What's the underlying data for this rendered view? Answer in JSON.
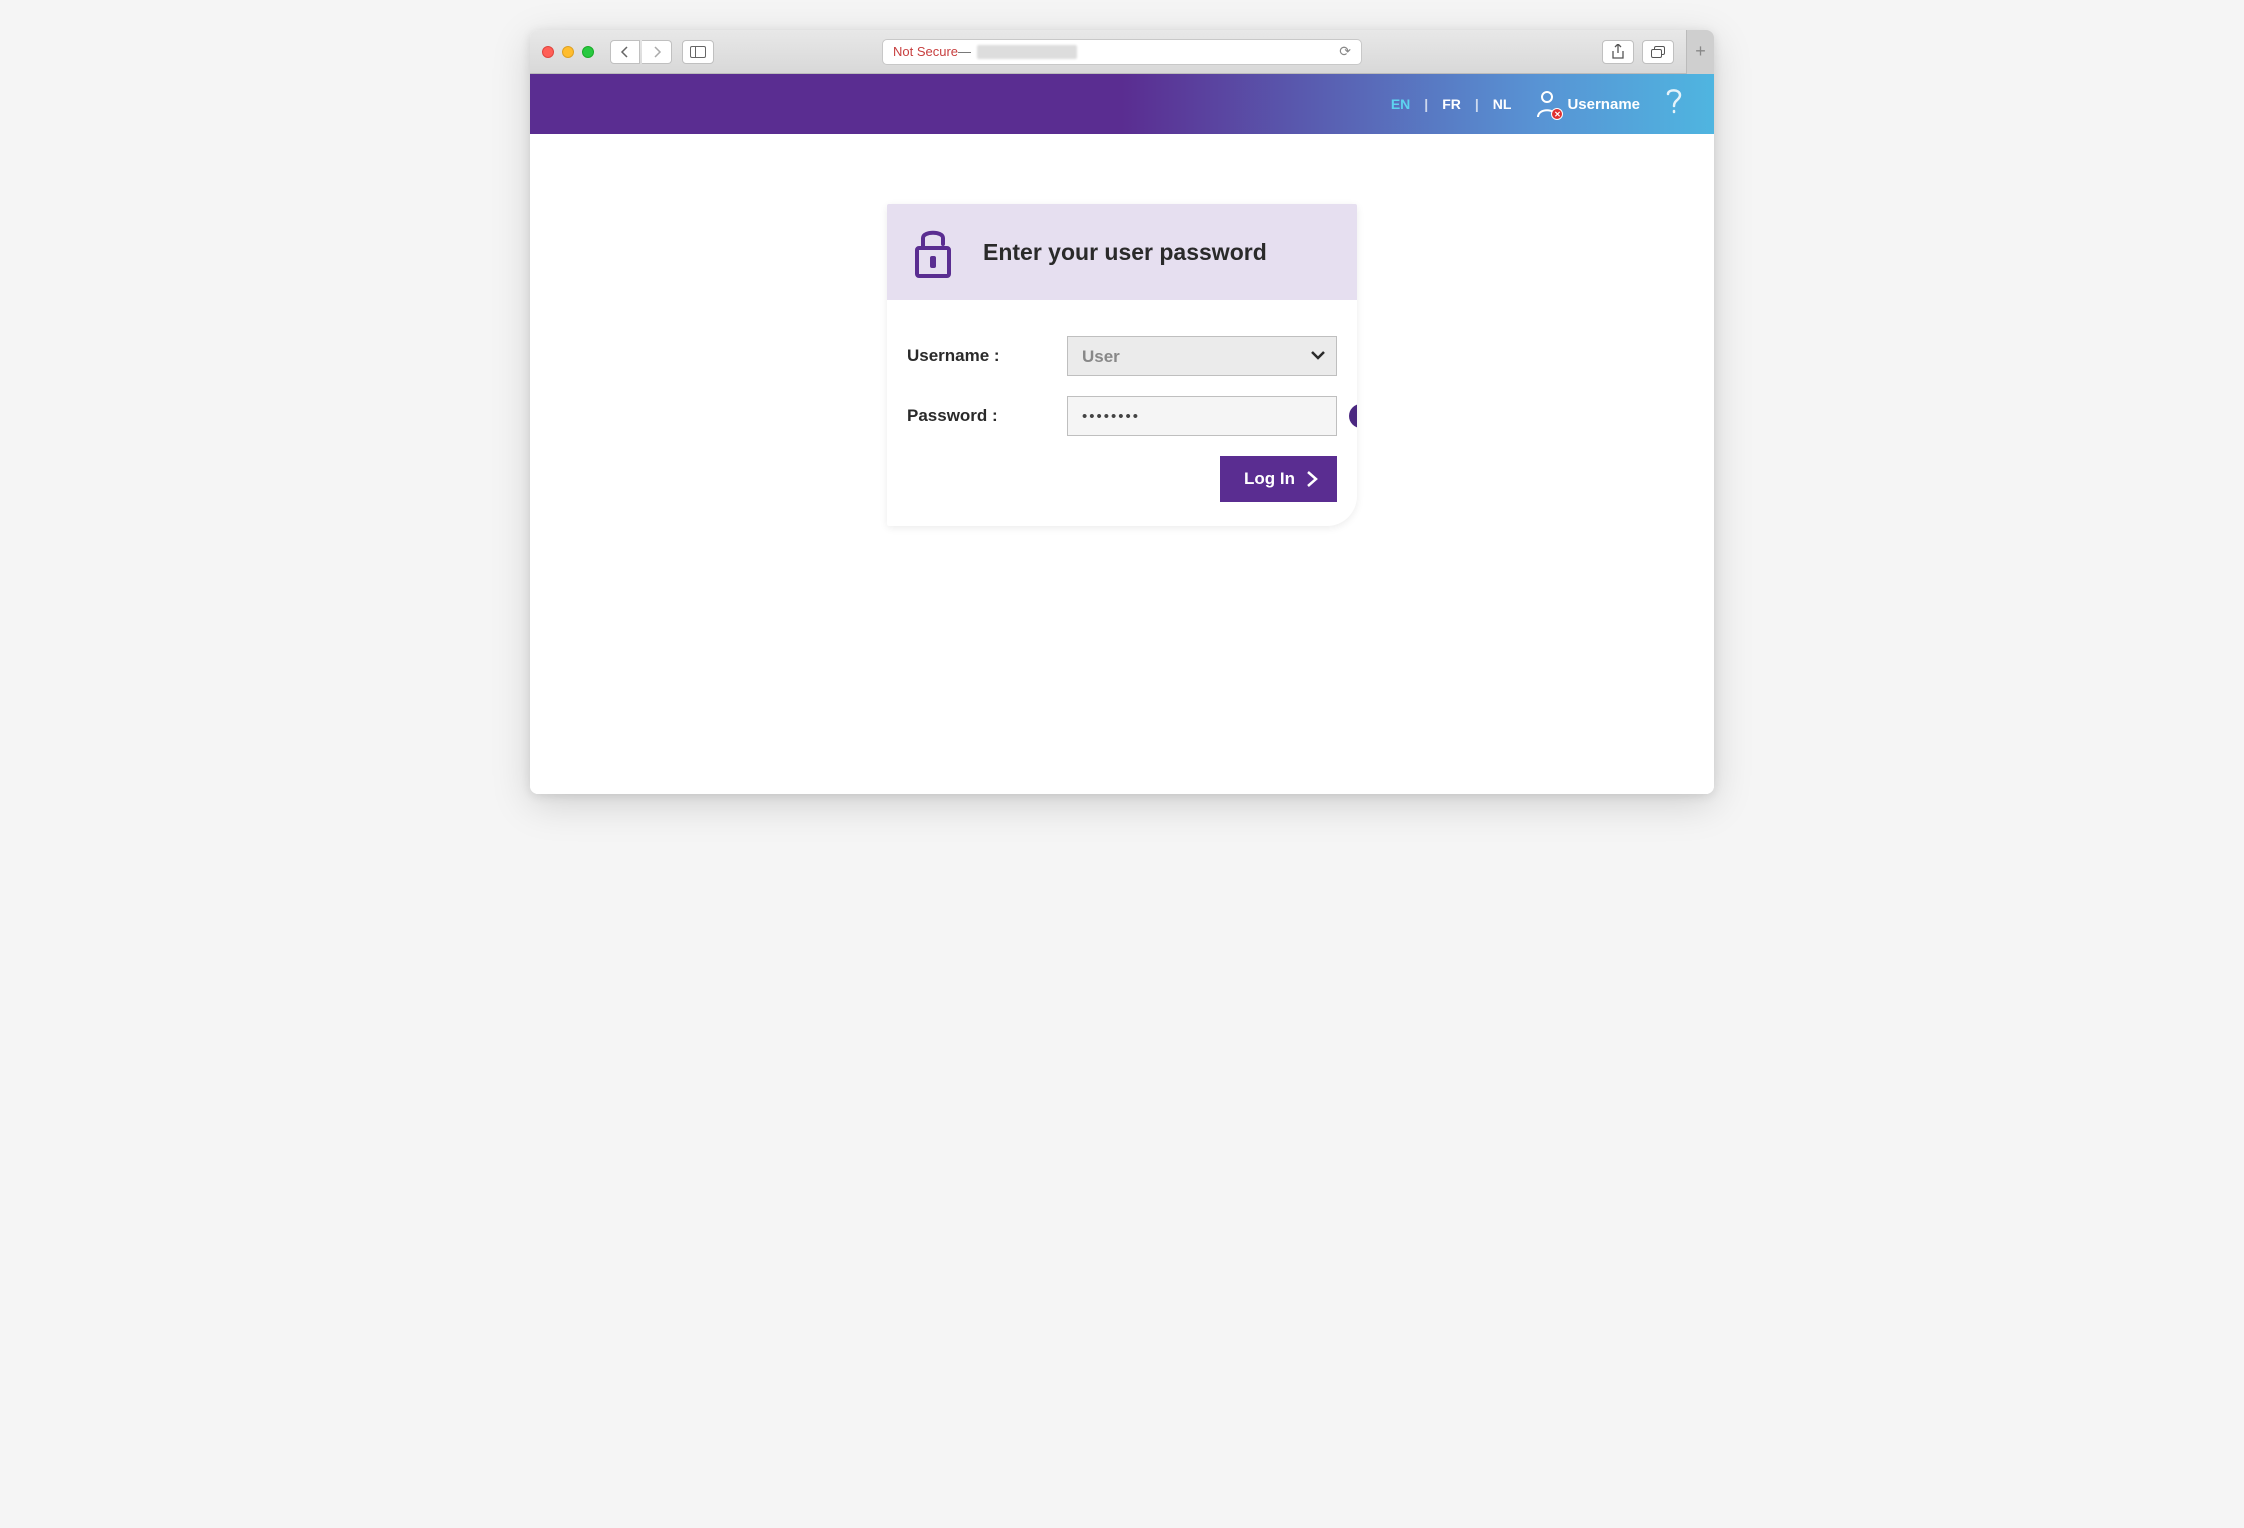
{
  "browser": {
    "not_secure_label": "Not Secure",
    "separator": " — "
  },
  "header": {
    "languages": [
      "EN",
      "FR",
      "NL"
    ],
    "active_language": "EN",
    "username_label": "Username"
  },
  "card": {
    "title": "Enter your user password",
    "username_label": "Username :",
    "password_label": "Password :",
    "username_value": "User",
    "password_value": "••••••••",
    "login_button": "Log In"
  }
}
